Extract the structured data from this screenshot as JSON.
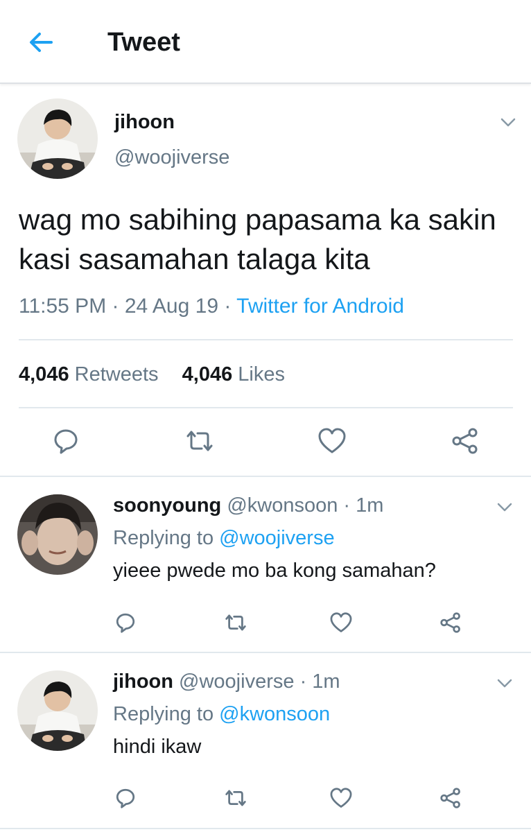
{
  "header": {
    "title": "Tweet",
    "back_icon": "arrow-left-icon",
    "accent": "#1da1f2"
  },
  "main_tweet": {
    "name": "jihoon",
    "handle": "@woojiverse",
    "text": "wag mo sabihing papasama ka sakin kasi sasamahan talaga kita",
    "time": "11:55 PM",
    "date": "24 Aug 19",
    "source": "Twitter for Android",
    "retweets_count": "4,046",
    "retweets_label": "Retweets",
    "likes_count": "4,046",
    "likes_label": "Likes"
  },
  "replies": [
    {
      "name": "soonyoung",
      "handle": "@kwonsoon",
      "time": "1m",
      "replying_label": "Replying to",
      "replying_to": "@woojiverse",
      "text": "yieee pwede mo ba kong samahan?"
    },
    {
      "name": "jihoon",
      "handle": "@woojiverse",
      "time": "1m",
      "replying_label": "Replying to",
      "replying_to": "@kwonsoon",
      "text": "hindi ikaw"
    }
  ],
  "separator": "·",
  "action_icons": [
    "reply-icon",
    "retweet-icon",
    "like-icon",
    "share-icon"
  ]
}
